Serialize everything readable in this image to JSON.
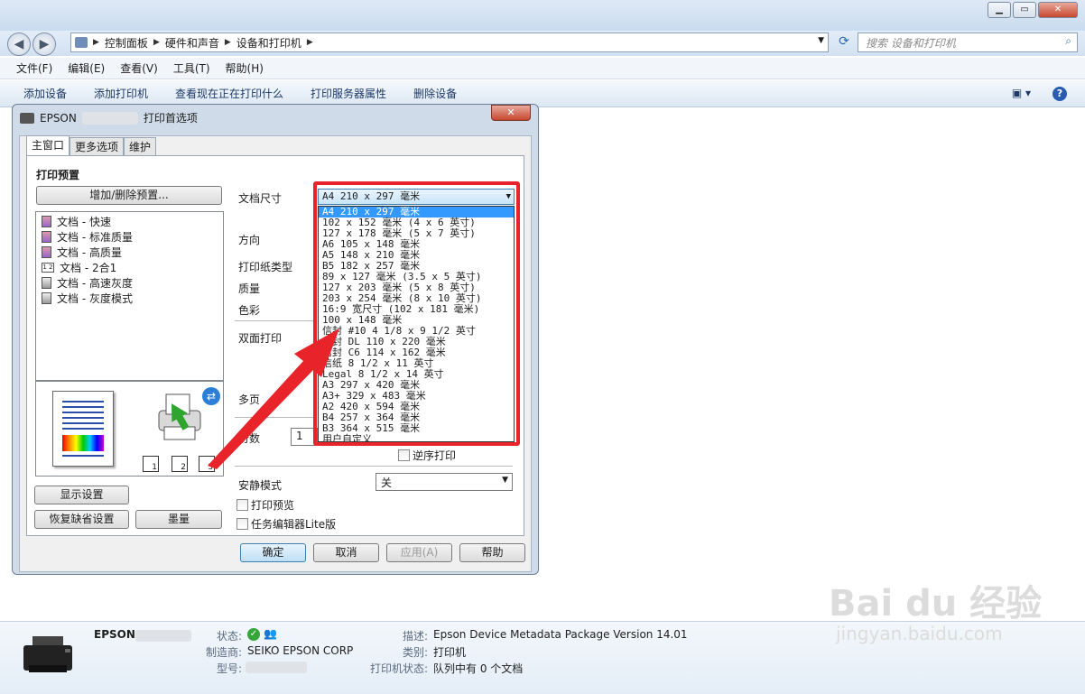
{
  "window": {
    "minimize": "▁",
    "maximize": "▭",
    "close": "✕"
  },
  "nav": {
    "back": "◀",
    "forward": "▶",
    "breadcrumbs": [
      "控制面板",
      "硬件和声音",
      "设备和打印机"
    ],
    "search_placeholder": "搜索 设备和打印机"
  },
  "menu": [
    "文件(F)",
    "编辑(E)",
    "查看(V)",
    "工具(T)",
    "帮助(H)"
  ],
  "commands": [
    "添加设备",
    "添加打印机",
    "查看现在正在打印什么",
    "打印服务器属性",
    "删除设备"
  ],
  "dialog": {
    "title_prefix": "EPSON",
    "title_suffix": "打印首选项",
    "tabs": [
      "主窗口",
      "更多选项",
      "维护"
    ],
    "preset_heading": "打印预置",
    "add_remove_button": "增加/删除预置...",
    "presets": [
      "文档 - 快速",
      "文档 - 标准质量",
      "文档 - 高质量",
      "文档 - 2合1",
      "文档 - 高速灰度",
      "文档 - 灰度模式"
    ],
    "labels": {
      "paper_size": "文档尺寸",
      "orientation": "方向",
      "paper_type": "打印纸类型",
      "quality": "质量",
      "color": "色彩",
      "duplex": "双面打印",
      "multipage": "多页",
      "copies": "份数",
      "quiet_mode": "安静模式"
    },
    "copies_value": "1",
    "reverse_order": "逆序打印",
    "quiet_mode_value": "关",
    "print_preview": "打印预览",
    "job_arranger": "任务编辑器Lite版",
    "show_settings": "显示设置",
    "restore_defaults": "恢复缺省设置",
    "ink_levels": "墨量",
    "ok": "确定",
    "cancel": "取消",
    "apply": "应用(A)",
    "help": "帮助",
    "pager_numbers": [
      "1",
      "2",
      "3"
    ]
  },
  "paper_size": {
    "selected": "A4 210 x 297 毫米",
    "options": [
      "A4 210 x 297 毫米",
      "102 x 152 毫米 (4 x 6 英寸)",
      "127 x 178 毫米 (5 x 7 英寸)",
      "A6 105 x 148 毫米",
      "A5 148 x 210 毫米",
      "B5 182 x 257 毫米",
      "89 x 127 毫米 (3.5 x 5 英寸)",
      "127 x 203 毫米 (5 x 8 英寸)",
      "203 x 254 毫米 (8 x 10 英寸)",
      "16:9 宽尺寸 (102 x 181 毫米)",
      "100 x 148 毫米",
      "信封 #10 4 1/8 x 9 1/2 英寸",
      "信封 DL  110 x 220 毫米",
      "信封 C6  114 x 162 毫米",
      "信纸 8 1/2 x 11 英寸",
      "Legal 8 1/2 x 14 英寸",
      "A3 297 x 420 毫米",
      "A3+ 329 x 483 毫米",
      "A2 420 x 594 毫米",
      "B4 257 x 364 毫米",
      "B3 364 x 515 毫米",
      "用户自定义"
    ]
  },
  "details": {
    "name": "EPSON",
    "status_label": "状态:",
    "manufacturer_label": "制造商:",
    "manufacturer": "SEIKO EPSON CORP",
    "model_label": "型号:",
    "description_label": "描述:",
    "description": "Epson Device Metadata Package Version 14.01",
    "category_label": "类别:",
    "category": "打印机",
    "printer_status_label": "打印机状态:",
    "printer_status": "队列中有 0 个文档"
  },
  "watermark": {
    "brand": "Bai du 经验",
    "site": "jingyan.baidu.com"
  }
}
